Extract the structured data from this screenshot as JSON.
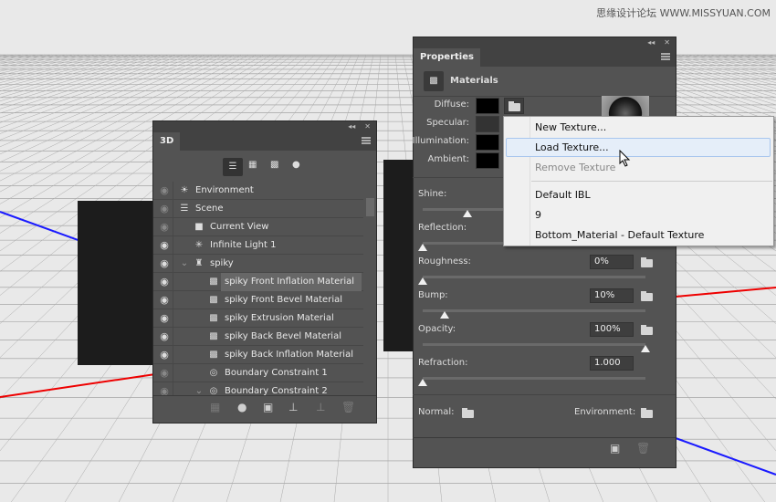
{
  "watermark": "思缘设计论坛 WWW.MISSYUAN.COM",
  "panel3d": {
    "tab": "3D",
    "filter_icons": [
      "scene-filter-icon",
      "mesh-filter-icon",
      "material-filter-icon",
      "light-filter-icon"
    ],
    "rows": [
      {
        "label": "Environment",
        "icon": "environment-icon",
        "visible": "dim"
      },
      {
        "label": "Scene",
        "icon": "scene-icon",
        "visible": "dim"
      },
      {
        "label": "Current View",
        "icon": "camera-icon",
        "visible": "dim"
      },
      {
        "label": "Infinite Light 1",
        "icon": "light-icon",
        "visible": "on"
      },
      {
        "label": "spiky",
        "icon": "mesh-icon",
        "visible": "on"
      },
      {
        "label": "spiky Front Inflation Material",
        "icon": "material-icon",
        "visible": "on"
      },
      {
        "label": "spiky Front Bevel Material",
        "icon": "material-icon",
        "visible": "on"
      },
      {
        "label": "spiky Extrusion Material",
        "icon": "material-icon",
        "visible": "on"
      },
      {
        "label": "spiky Back Bevel Material",
        "icon": "material-icon",
        "visible": "on"
      },
      {
        "label": "spiky Back Inflation Material",
        "icon": "material-icon",
        "visible": "on"
      },
      {
        "label": "Boundary Constraint 1",
        "icon": "constraint-icon",
        "visible": "dim"
      },
      {
        "label": "Boundary Constraint 2",
        "icon": "constraint-icon",
        "visible": "dim"
      }
    ]
  },
  "properties": {
    "tab": "Properties",
    "section": "Materials",
    "diffuse": "Diffuse:",
    "specular": "Specular:",
    "illumination": "Illumination:",
    "ambient": "Ambient:",
    "shine": {
      "label": "Shine:",
      "value": 0.2
    },
    "reflection": {
      "label": "Reflection:",
      "value": 0
    },
    "roughness": {
      "label": "Roughness:",
      "value": "0%",
      "fraction": 0
    },
    "bump": {
      "label": "Bump:",
      "value": "10%",
      "fraction": 0.1
    },
    "opacity": {
      "label": "Opacity:",
      "value": "100%",
      "fraction": 1
    },
    "refraction": {
      "label": "Refraction:",
      "value": "1.000",
      "fraction": 0
    },
    "normal": "Normal:",
    "environment": "Environment:"
  },
  "texture_menu": {
    "items": [
      "New Texture...",
      "Load Texture...",
      "Remove Texture",
      "Default IBL",
      "9",
      "Bottom_Material - Default Texture"
    ],
    "highlighted": "Load Texture...",
    "disabled": "Remove Texture"
  }
}
